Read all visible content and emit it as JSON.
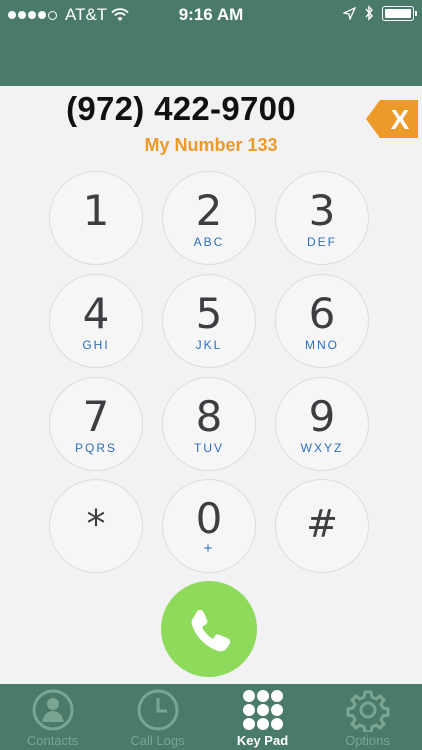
{
  "status_bar": {
    "carrier": "AT&T",
    "time": "9:16 AM"
  },
  "dialer": {
    "number": "(972) 422-9700",
    "caller_id_label": "My Number 133",
    "backspace_label": "X"
  },
  "keypad": [
    {
      "digit": "1",
      "letters": ""
    },
    {
      "digit": "2",
      "letters": "ABC"
    },
    {
      "digit": "3",
      "letters": "DEF"
    },
    {
      "digit": "4",
      "letters": "GHI"
    },
    {
      "digit": "5",
      "letters": "JKL"
    },
    {
      "digit": "6",
      "letters": "MNO"
    },
    {
      "digit": "7",
      "letters": "PQRS"
    },
    {
      "digit": "8",
      "letters": "TUV"
    },
    {
      "digit": "9",
      "letters": "WXYZ"
    },
    {
      "digit": "*",
      "letters": ""
    },
    {
      "digit": "0",
      "letters": "+"
    },
    {
      "digit": "#",
      "letters": ""
    }
  ],
  "tabs": [
    {
      "label": "Contacts",
      "icon": "contacts-icon",
      "active": false
    },
    {
      "label": "Call Logs",
      "icon": "clock-icon",
      "active": false
    },
    {
      "label": "Key Pad",
      "icon": "keypad-icon",
      "active": true
    },
    {
      "label": "Options",
      "icon": "gear-icon",
      "active": false
    }
  ],
  "colors": {
    "header": "#4a7a69",
    "accent_orange": "#ec9a2a",
    "call_green": "#8edb5c",
    "letters_blue": "#2e6ebf"
  }
}
